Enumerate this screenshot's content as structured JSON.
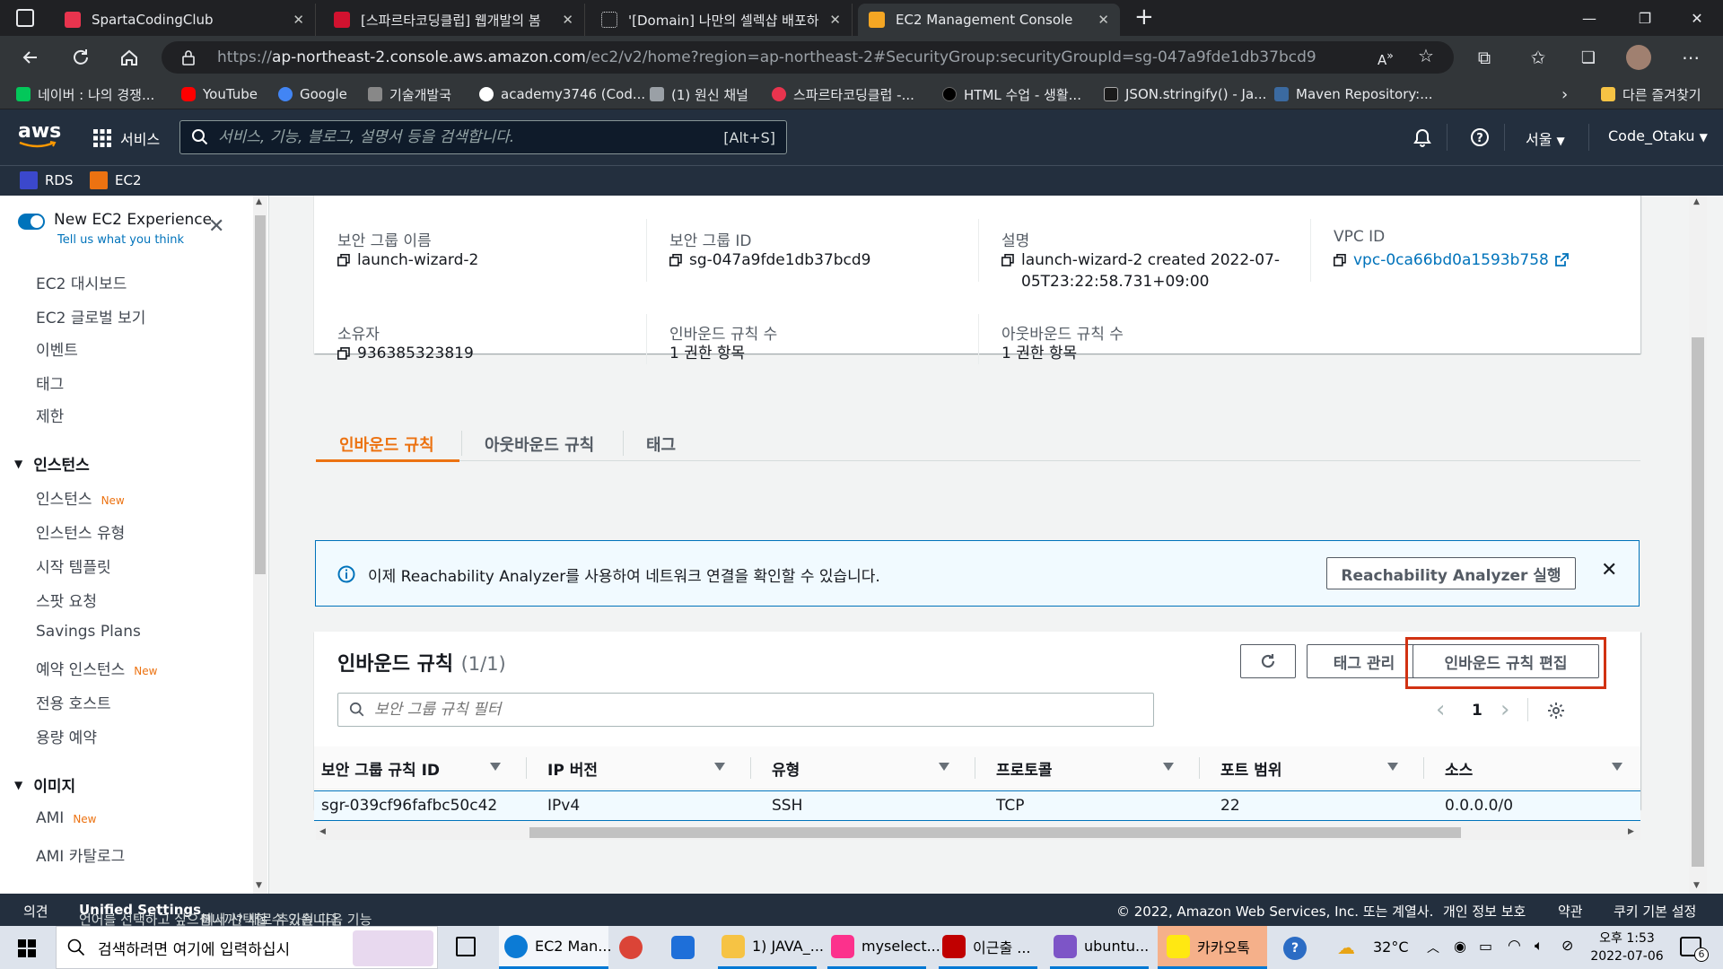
{
  "browser": {
    "tabs": [
      {
        "title": "SpartaCodingClub",
        "icon_color": "#e8344e"
      },
      {
        "title": "[스파르타코딩클럽] 웹개발의 봄",
        "icon_color": "#d1122f"
      },
      {
        "title": "'[Domain] 나만의 셀렉샵 배포하",
        "icon_color": "#ffffff"
      },
      {
        "title": "EC2 Management Console",
        "icon_color": "#f5a623"
      }
    ],
    "new_tab": "+",
    "url_prefix": "https://",
    "url_host": "ap-northeast-2.console.aws.amazon.com",
    "url_path": "/ec2/v2/home?region=ap-northeast-2#SecurityGroup:securityGroupId=sg-047a9fde1db37bcd9",
    "bookmarks": [
      {
        "label": "네이버 : 나의 경쟁...",
        "icon_color": "#03c75a"
      },
      {
        "label": "YouTube",
        "icon_color": "#ff0000"
      },
      {
        "label": "Google",
        "icon_color": "#4285f4"
      },
      {
        "label": "기술개발국",
        "icon_color": "#888888"
      },
      {
        "label": "academy3746 (Cod...",
        "icon_color": "#ffffff"
      },
      {
        "label": "(1) 원신 채널",
        "icon_color": "#9aa0a6"
      },
      {
        "label": "스파르타코딩클럽 -...",
        "icon_color": "#e8344e"
      },
      {
        "label": "HTML 수업 - 생활...",
        "icon_color": "#000000"
      },
      {
        "label": "JSON.stringify() - Ja...",
        "icon_color": "#1a1a1a"
      },
      {
        "label": "Maven Repository:...",
        "icon_color": "#3b6aa0"
      }
    ],
    "other_bookmarks": "다른 즐겨찾기"
  },
  "aws": {
    "logo": "aws",
    "services": "서비스",
    "search_placeholder": "서비스, 기능, 블로그, 설명서 등을 검색합니다.",
    "search_shortcut": "[Alt+S]",
    "region": "서울",
    "account": "Code_Otaku",
    "favorites": [
      "RDS",
      "EC2"
    ]
  },
  "sidebar": {
    "toggle_title": "New EC2 Experience",
    "toggle_sub": "Tell us what you think",
    "new_badge": "New",
    "top_items": [
      "EC2 대시보드",
      "EC2 글로벌 보기",
      "이벤트",
      "태그",
      "제한"
    ],
    "instances_header": "인스턴스",
    "instances_items": [
      "인스턴스",
      "인스턴스 유형",
      "시작 템플릿",
      "스팟 요청",
      "Savings Plans",
      "예약 인스턴스",
      "전용 호스트",
      "용량 예약"
    ],
    "images_header": "이미지",
    "images_items": [
      "AMI",
      "AMI 카탈로그"
    ]
  },
  "details": {
    "name_label": "보안 그룹 이름",
    "name_value": "launch-wizard-2",
    "id_label": "보안 그룹 ID",
    "id_value": "sg-047a9fde1db37bcd9",
    "desc_label": "설명",
    "desc_value": "launch-wizard-2 created 2022-07-05T23:22:58.731+09:00",
    "vpc_label": "VPC ID",
    "vpc_value": "vpc-0ca66bd0a1593b758",
    "owner_label": "소유자",
    "owner_value": "936385323819",
    "inbound_count_label": "인바운드 규칙 수",
    "inbound_count_value": "1 권한 항목",
    "outbound_count_label": "아웃바운드 규칙 수",
    "outbound_count_value": "1 권한 항목"
  },
  "tabs": [
    "인바운드 규칙",
    "아웃바운드 규칙",
    "태그"
  ],
  "info_banner": {
    "text": "이제 Reachability Analyzer를 사용하여 네트워크 연결을 확인할 수 있습니다.",
    "button": "Reachability Analyzer 실행"
  },
  "rules": {
    "title": "인바운드 규칙",
    "count": "(1/1)",
    "manage_tags": "태그 관리",
    "edit_rules": "인바운드 규칙 편집",
    "filter_placeholder": "보안 그룹 규칙 필터",
    "page": "1",
    "columns": [
      "보안 그룹 규칙 ID",
      "IP 버전",
      "유형",
      "프로토콜",
      "포트 범위",
      "소스"
    ],
    "rows": [
      [
        "sgr-039cf96fafbc50c42",
        "IPv4",
        "SSH",
        "TCP",
        "22",
        "0.0.0.0/0"
      ]
    ],
    "highlight_color": "#d13212"
  },
  "footer": {
    "feedback": "의견",
    "lang_text": "언어를 선택하고 싶으십니까? 새로 추가된 다음 기능",
    "unified": "Unified Settings",
    "lang_text2": "에서 선택할 수 있습니다.",
    "copyright": "© 2022, Amazon Web Services, Inc. 또는 계열사.",
    "privacy": "개인 정보 보호",
    "terms": "약관",
    "cookies": "쿠키 기본 설정"
  },
  "taskbar": {
    "search_placeholder": "검색하려면 여기에 입력하십시",
    "apps": [
      {
        "label": "EC2 Man...",
        "icon_color": "#0c7bd5"
      },
      {
        "label": "",
        "icon_color": "#db4437"
      },
      {
        "label": "",
        "icon_color": "#1e6fd9"
      },
      {
        "label": "1) JAVA_...",
        "icon_color": "#f6c344"
      },
      {
        "label": "myselect...",
        "icon_color": "#fc318c"
      },
      {
        "label": "이근출 ...",
        "icon_color": "#c00000"
      },
      {
        "label": "ubuntu...",
        "icon_color": "#7d55c7"
      },
      {
        "label": "카카오톡",
        "icon_color": "#ffe812"
      }
    ],
    "temperature": "32°C",
    "time": "오후 1:53",
    "date": "2022-07-06",
    "notif_count": "6"
  }
}
